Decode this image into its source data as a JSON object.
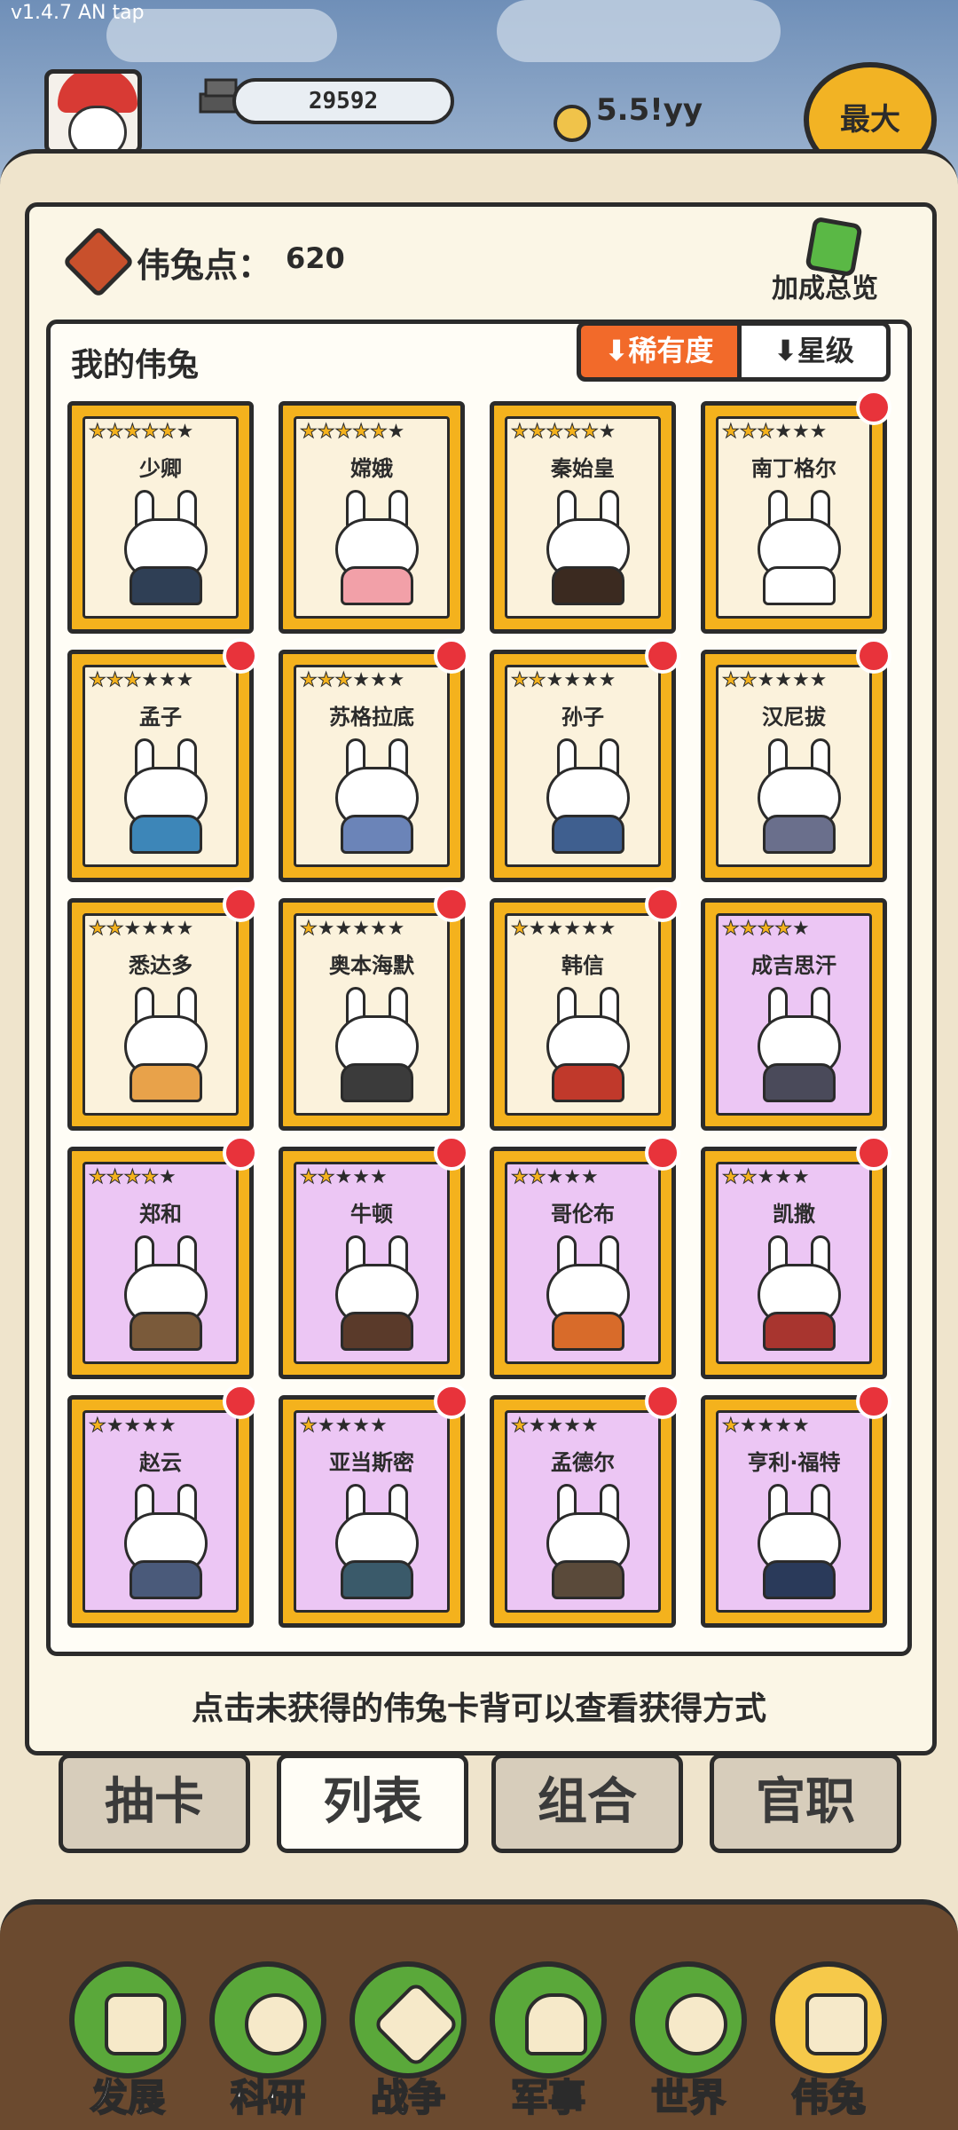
{
  "version": "v1.4.7 AN tap",
  "header": {
    "gold_amount": "29592",
    "income_rate": "5.5!yy",
    "max_button": "最大"
  },
  "points": {
    "label": "伟兔点：",
    "value": "620",
    "bonus_label": "加成总览"
  },
  "collection": {
    "title": "我的伟兔",
    "sort_rarity": "⬇稀有度",
    "sort_star": "⬇星级"
  },
  "cards": [
    {
      "name": "少卿",
      "stars": 6,
      "filled": 5,
      "color": "gold",
      "dot": false
    },
    {
      "name": "嫦娥",
      "stars": 6,
      "filled": 5,
      "color": "gold",
      "dot": false
    },
    {
      "name": "秦始皇",
      "stars": 6,
      "filled": 5,
      "color": "gold",
      "dot": false
    },
    {
      "name": "南丁格尔",
      "stars": 6,
      "filled": 3,
      "color": "gold",
      "dot": true
    },
    {
      "name": "孟子",
      "stars": 6,
      "filled": 3,
      "color": "gold",
      "dot": true
    },
    {
      "name": "苏格拉底",
      "stars": 6,
      "filled": 3,
      "color": "gold",
      "dot": true
    },
    {
      "name": "孙子",
      "stars": 6,
      "filled": 2,
      "color": "gold",
      "dot": true
    },
    {
      "name": "汉尼拔",
      "stars": 6,
      "filled": 2,
      "color": "gold",
      "dot": true
    },
    {
      "name": "悉达多",
      "stars": 6,
      "filled": 2,
      "color": "gold",
      "dot": true
    },
    {
      "name": "奥本海默",
      "stars": 6,
      "filled": 1,
      "color": "gold",
      "dot": true
    },
    {
      "name": "韩信",
      "stars": 6,
      "filled": 1,
      "color": "gold",
      "dot": true
    },
    {
      "name": "成吉思汗",
      "stars": 5,
      "filled": 4,
      "color": "purple",
      "dot": false
    },
    {
      "name": "郑和",
      "stars": 5,
      "filled": 4,
      "color": "purple",
      "dot": true
    },
    {
      "name": "牛顿",
      "stars": 5,
      "filled": 2,
      "color": "purple",
      "dot": true
    },
    {
      "name": "哥伦布",
      "stars": 5,
      "filled": 2,
      "color": "purple",
      "dot": true
    },
    {
      "name": "凯撒",
      "stars": 5,
      "filled": 2,
      "color": "purple",
      "dot": true
    },
    {
      "name": "赵云",
      "stars": 5,
      "filled": 1,
      "color": "purple",
      "dot": true
    },
    {
      "name": "亚当斯密",
      "stars": 5,
      "filled": 1,
      "color": "purple",
      "dot": true
    },
    {
      "name": "孟德尔",
      "stars": 5,
      "filled": 1,
      "color": "purple",
      "dot": true
    },
    {
      "name": "亨利·福特",
      "stars": 5,
      "filled": 1,
      "color": "purple",
      "dot": true
    }
  ],
  "hint": "点击未获得的伟兔卡背可以查看获得方式",
  "tabs": [
    {
      "label": "抽卡",
      "active": false
    },
    {
      "label": "列表",
      "active": true
    },
    {
      "label": "组合",
      "active": false
    },
    {
      "label": "官职",
      "active": false
    }
  ],
  "nav": [
    {
      "label": "发展",
      "icon": "arrow-up-icon",
      "active": false
    },
    {
      "label": "科研",
      "icon": "flask-icon",
      "active": false
    },
    {
      "label": "战争",
      "icon": "swords-icon",
      "active": false
    },
    {
      "label": "军事",
      "icon": "helmet-icon",
      "active": false
    },
    {
      "label": "世界",
      "icon": "globe-icon",
      "active": false
    },
    {
      "label": "伟兔",
      "icon": "bunny-card-icon",
      "active": true
    }
  ],
  "colors": {
    "accent_orange": "#f26a2a",
    "card_gold": "#f4b21d",
    "card_purple_bg": "#ecc6f4",
    "nav_green": "#5aa83a",
    "nav_active": "#f6c94a",
    "notify_red": "#e8333b"
  }
}
